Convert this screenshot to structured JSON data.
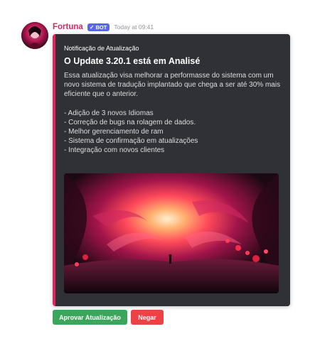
{
  "message": {
    "username": "Fortuna",
    "bot_badge": "BOT",
    "timestamp": "Today at 09:41"
  },
  "embed": {
    "accent_color": "#e0245e",
    "author": "Notificação de Atualização",
    "title": "O Update 3.20.1 está em Analisé",
    "description": "Essa atualização visa melhorar a performasse do sistema com um novo sistema de tradução implantado que chega a ser até 30% mais eficiente que o anterior.",
    "features": [
      "- Adição de 3 novos Idiomas",
      "- Correção de bugs na rolagem de dados.",
      "- Melhor gerenciamento de ram",
      "- Sistema de confirmação em atualizações",
      "- Integração com novos clientes"
    ]
  },
  "buttons": {
    "approve_label": "Aprovar Atualização",
    "approve_color": "#3ba55c",
    "deny_label": "Negar",
    "deny_color": "#ed4245"
  }
}
